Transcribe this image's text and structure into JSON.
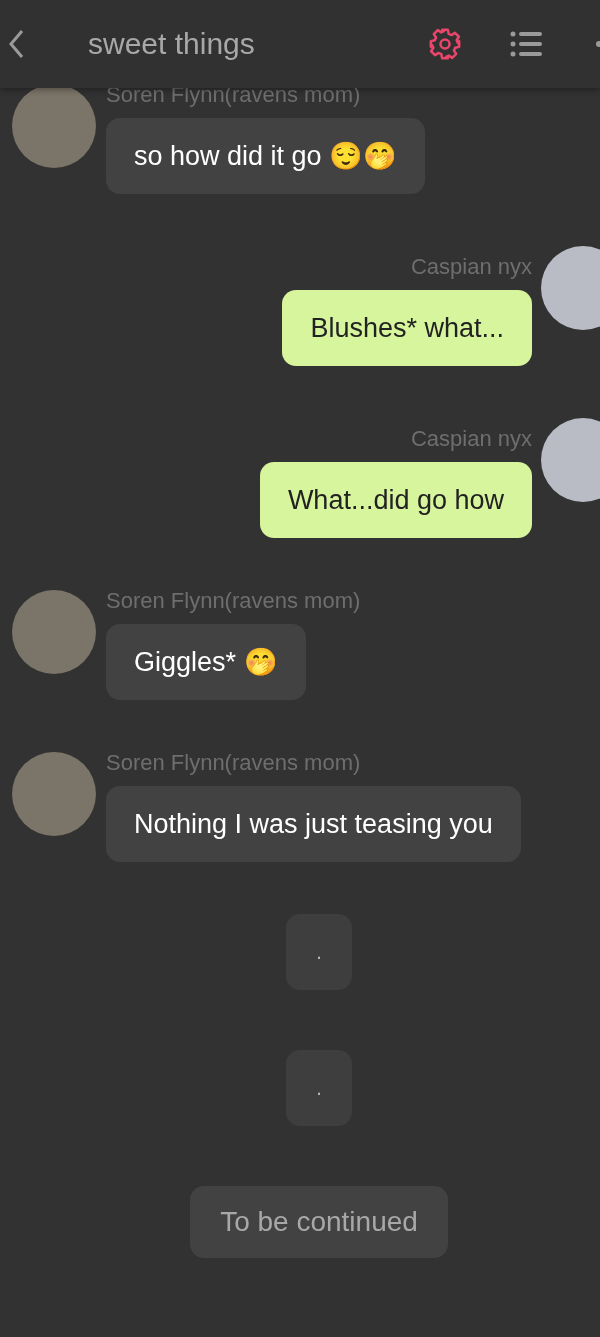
{
  "header": {
    "title": "sweet things"
  },
  "messages": [
    {
      "kind": "incoming",
      "name": "Soren Flynn(ravens mom)",
      "text": "so how did it go 😌🤭"
    },
    {
      "kind": "outgoing",
      "name": "Caspian nyx",
      "text": "Blushes* what..."
    },
    {
      "kind": "outgoing",
      "name": "Caspian nyx",
      "text": "What...did go how"
    },
    {
      "kind": "incoming",
      "name": "Soren Flynn(ravens mom)",
      "text": "Giggles* 🤭"
    },
    {
      "kind": "incoming",
      "name": "Soren Flynn(ravens mom)",
      "text": "Nothing I was just teasing you"
    },
    {
      "kind": "narration",
      "text": "."
    },
    {
      "kind": "narration",
      "text": "."
    }
  ],
  "footer": {
    "label": "To be continued"
  }
}
